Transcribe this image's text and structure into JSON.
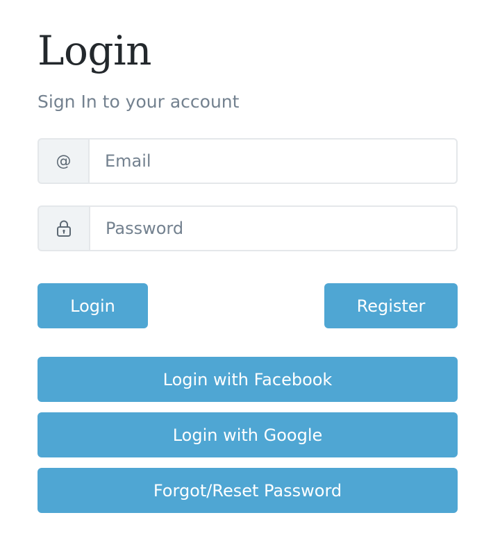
{
  "header": {
    "title": "Login",
    "subtitle": "Sign In to your account"
  },
  "form": {
    "email": {
      "addon": "@",
      "placeholder": "Email",
      "value": ""
    },
    "password": {
      "icon": "lock-icon",
      "placeholder": "Password",
      "value": ""
    }
  },
  "actions": {
    "login": "Login",
    "register": "Register"
  },
  "social": {
    "facebook": "Login with Facebook",
    "google": "Login with Google",
    "reset": "Forgot/Reset Password"
  },
  "colors": {
    "button": "#4fa6d3",
    "addon_bg": "#f0f3f5",
    "border": "#e4e7ea",
    "muted_text": "#73818f"
  }
}
